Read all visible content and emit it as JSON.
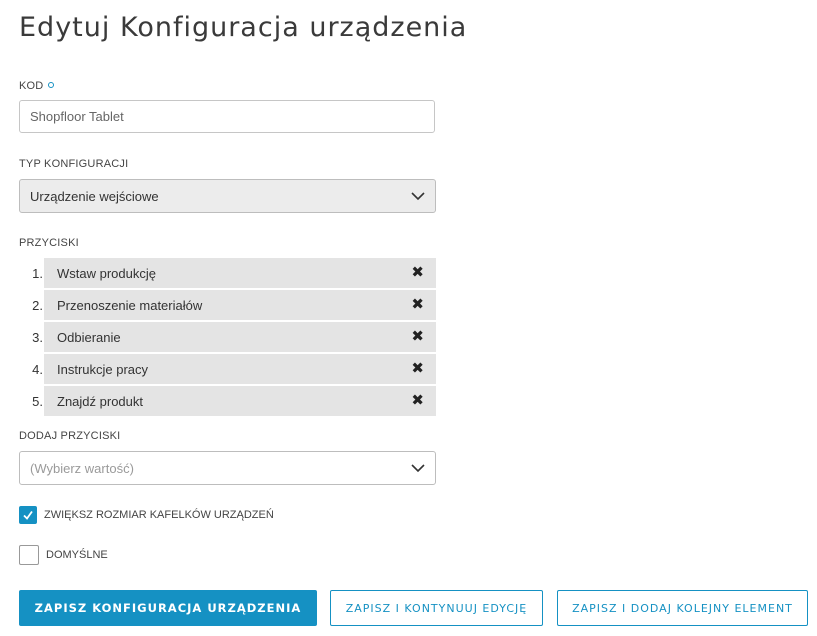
{
  "page": {
    "title": "Edytuj Konfiguracja urządzenia"
  },
  "fields": {
    "code": {
      "label": "KOD",
      "value": "Shopfloor Tablet"
    },
    "config_type": {
      "label": "TYP KONFIGURACJI",
      "value": "Urządzenie wejściowe"
    },
    "buttons": {
      "label": "PRZYCISKI",
      "items": [
        {
          "num": "1.",
          "label": "Wstaw produkcję"
        },
        {
          "num": "2.",
          "label": "Przenoszenie materiałów"
        },
        {
          "num": "3.",
          "label": "Odbieranie"
        },
        {
          "num": "4.",
          "label": "Instrukcje pracy"
        },
        {
          "num": "5.",
          "label": "Znajdź produkt"
        }
      ],
      "remove_glyph": "✖"
    },
    "add_buttons": {
      "label": "DODAJ PRZYCISKI",
      "placeholder": "(Wybierz wartość)"
    },
    "enlarge_tiles": {
      "label": "ZWIĘKSZ ROZMIAR KAFELKÓW URZĄDZEŃ",
      "checked": true
    },
    "default": {
      "label": "DOMYŚLNE",
      "checked": false
    }
  },
  "actions": {
    "save": "ZAPISZ KONFIGURACJA URZĄDZENIA",
    "save_continue": "ZAPISZ I KONTYNUUJ EDYCJĘ",
    "save_add": "ZAPISZ I DODAJ KOLEJNY ELEMENT"
  },
  "colors": {
    "accent": "#1591c3",
    "list_bg": "#e4e4e4",
    "select_bg": "#ececec"
  }
}
